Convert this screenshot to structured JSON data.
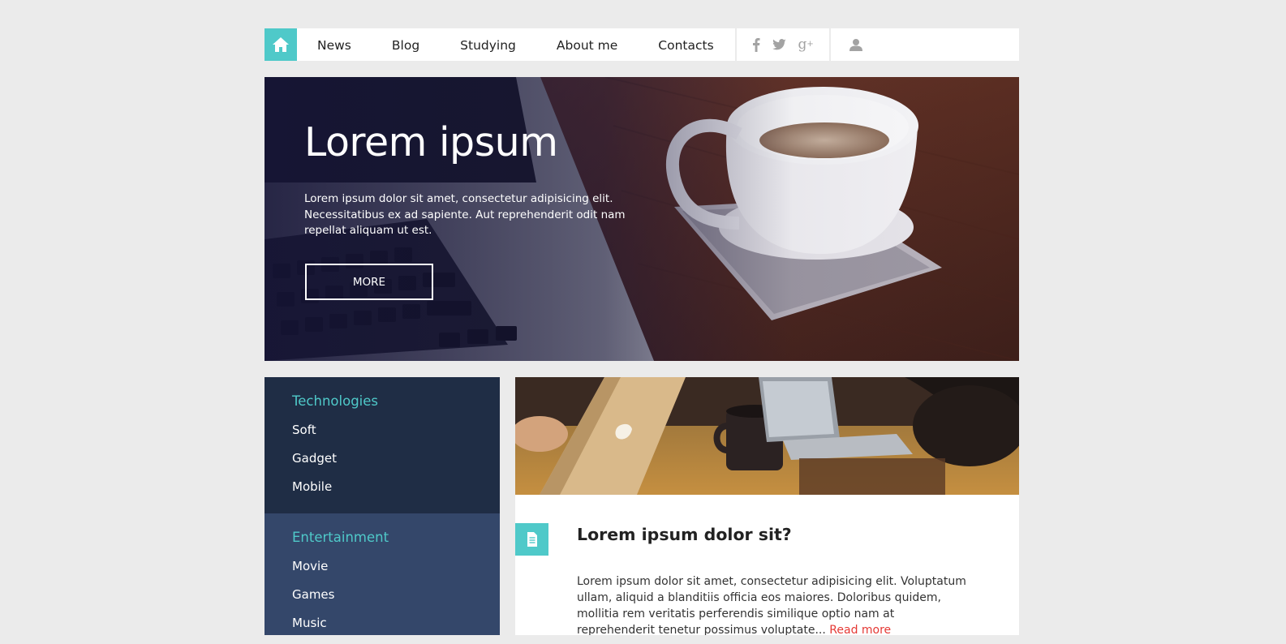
{
  "nav": {
    "items": [
      "News",
      "Blog",
      "Studying",
      "About me",
      "Contacts"
    ],
    "social": [
      {
        "name": "facebook-icon",
        "glyph": "f"
      },
      {
        "name": "twitter-icon",
        "glyph": "t"
      },
      {
        "name": "google-plus-icon",
        "glyph": "g+"
      }
    ]
  },
  "hero": {
    "title": "Lorem ipsum",
    "text": "Lorem ipsum dolor sit amet, consectetur adipisicing elit. Necessitatibus ex ad sapiente. Aut reprehenderit odit nam repellat aliquam ut est.",
    "button": "MORE"
  },
  "sidebar": {
    "sections": [
      {
        "heading": "Technologies",
        "items": [
          "Soft",
          "Gadget",
          "Mobile"
        ]
      },
      {
        "heading": "Entertainment",
        "items": [
          "Movie",
          "Games",
          "Music"
        ]
      }
    ]
  },
  "article": {
    "title": "Lorem ipsum dolor sit?",
    "body": "Lorem ipsum dolor sit amet, consectetur adipisicing elit. Voluptatum ullam, aliquid a blanditiis officia eos maiores. Doloribus quidem, mollitia rem veritatis perferendis similique optio nam at reprehenderit tenetur possimus voluptate...",
    "read_more": "Read more"
  },
  "colors": {
    "accent": "#4fc9c9",
    "sidebar_dark": "#1f2d45",
    "sidebar_light": "#34476a",
    "link_red": "#e53935"
  }
}
